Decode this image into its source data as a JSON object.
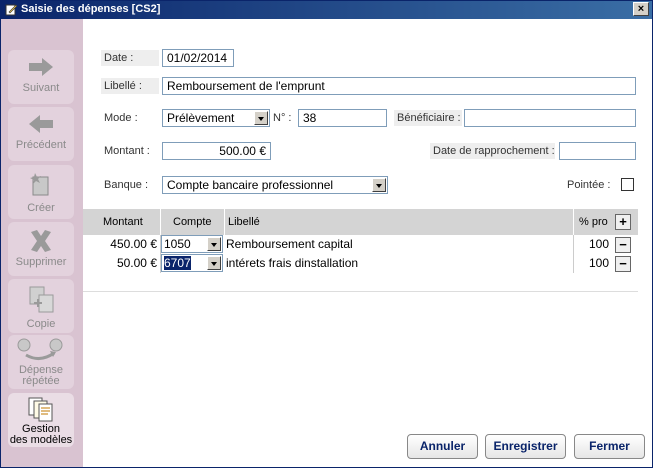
{
  "window": {
    "title": "Saisie des dépenses [CS2]",
    "close": "×"
  },
  "sidebar": {
    "items": [
      {
        "label": "Suivant",
        "icon": "arrow-right-icon"
      },
      {
        "label": "Précédent",
        "icon": "arrow-left-icon"
      },
      {
        "label": "Créer",
        "icon": "new-document-icon"
      },
      {
        "label": "Supprimer",
        "icon": "delete-x-icon"
      },
      {
        "label": "Copie",
        "icon": "copy-document-icon"
      },
      {
        "label": "Dépense",
        "label2": "répétée",
        "icon": "repeat-expense-icon"
      },
      {
        "label": "Gestion",
        "label2": "des modèles",
        "icon": "templates-icon"
      }
    ]
  },
  "form": {
    "date_label": "Date :",
    "date_value": "01/02/2014",
    "libelle_label": "Libellé :",
    "libelle_value": "Remboursement de l'emprunt",
    "mode_label": "Mode :",
    "mode_value": "Prélèvement",
    "no_label": "N° :",
    "no_value": "38",
    "beneficiaire_label": "Bénéficiaire :",
    "beneficiaire_value": "",
    "montant_label": "Montant :",
    "montant_value": "500.00 €",
    "rapprochement_label": "Date de rapprochement :",
    "rapprochement_value": "",
    "banque_label": "Banque :",
    "banque_value": "Compte bancaire professionnel",
    "pointee_label": "Pointée :",
    "pointee_checked": false
  },
  "table": {
    "headers": {
      "montant": "Montant",
      "compte": "Compte",
      "libelle": "Libellé",
      "pct": "% pro",
      "add": "+"
    },
    "rows": [
      {
        "montant": "450.00 €",
        "compte": "1050",
        "libelle": "Remboursement capital",
        "pct": "100",
        "remove": "−"
      },
      {
        "montant": "50.00 €",
        "compte": "6707",
        "libelle": "intérets frais dinstallation",
        "pct": "100",
        "remove": "−"
      }
    ]
  },
  "buttons": {
    "annuler": "Annuler",
    "enregistrer": "Enregistrer",
    "fermer": "Fermer"
  },
  "colors": {
    "titlebar": "#0a246a",
    "sidebar": "#d9c3d1",
    "button_text": "#0a246a"
  }
}
